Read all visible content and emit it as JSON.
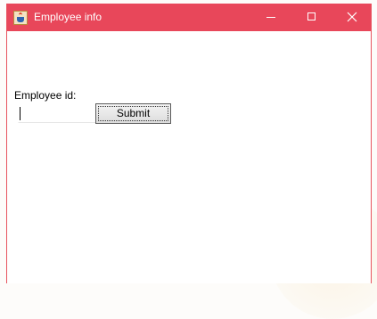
{
  "window": {
    "title": "Employee info",
    "app_icon": "java-cup-icon",
    "controls": {
      "minimize": "minimize-icon",
      "maximize": "maximize-icon",
      "close": "close-icon"
    }
  },
  "form": {
    "employee_id_label": "Employee id:",
    "employee_id_value": "",
    "submit_label": "Submit"
  },
  "colors": {
    "titlebar": "#e8475a",
    "titlebar_text": "#ffffff",
    "window_background": "#ffffff"
  }
}
